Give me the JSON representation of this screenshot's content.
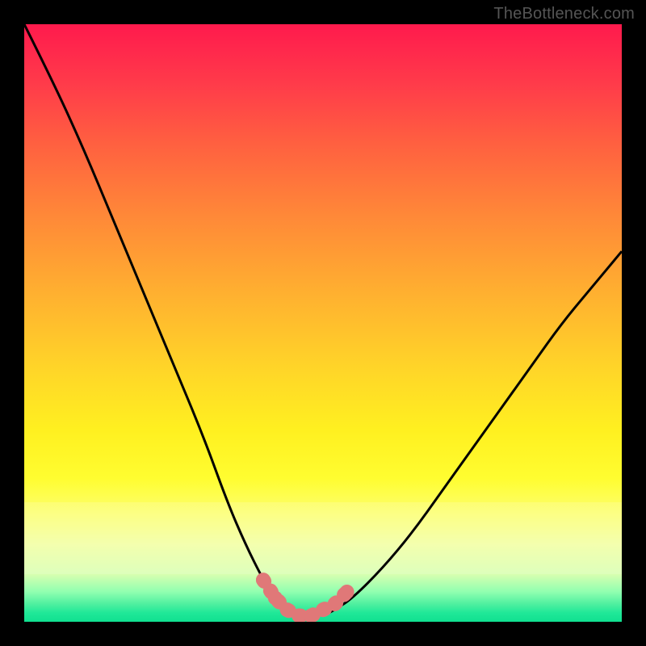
{
  "watermark": "TheBottleneck.com",
  "chart_data": {
    "type": "line",
    "title": "",
    "xlabel": "",
    "ylabel": "",
    "xlim": [
      0,
      100
    ],
    "ylim": [
      0,
      100
    ],
    "series": [
      {
        "name": "bottleneck-curve",
        "x": [
          0,
          5,
          10,
          15,
          20,
          25,
          30,
          34,
          37,
          40,
          42,
          44,
          46,
          50,
          52,
          55,
          60,
          65,
          70,
          75,
          80,
          85,
          90,
          95,
          100
        ],
        "y": [
          100,
          90,
          79,
          67,
          55,
          43,
          31,
          20,
          13,
          7,
          4,
          2,
          1,
          1,
          2,
          4,
          9,
          15,
          22,
          29,
          36,
          43,
          50,
          56,
          62
        ]
      }
    ],
    "marker_region": {
      "name": "optimal-zone",
      "x": [
        40,
        42,
        44,
        46,
        48,
        50,
        52,
        54
      ],
      "y": [
        7,
        4,
        2,
        1,
        1,
        2,
        3,
        5
      ]
    },
    "background_gradient": {
      "top": "#ff1a4d",
      "mid": "#ffd628",
      "bottom": "#10e090"
    }
  }
}
